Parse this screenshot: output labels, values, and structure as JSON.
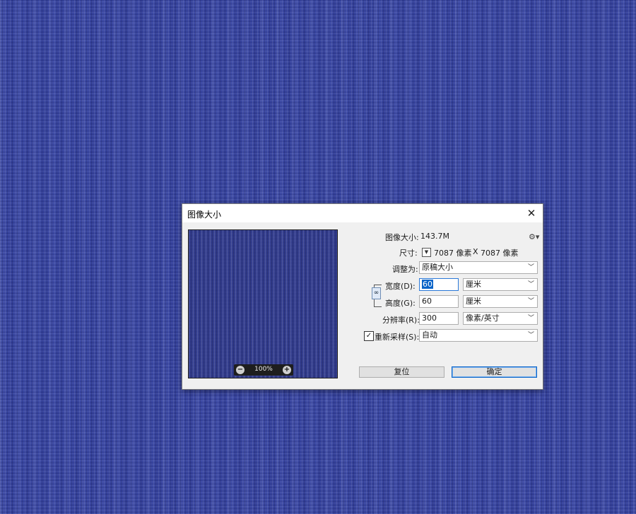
{
  "dialog": {
    "title": "图像大小",
    "close_icon": "close-icon",
    "image_size_label": "图像大小:",
    "image_size_value": "143.7M",
    "dimensions_label": "尺寸:",
    "dimensions_width": "7087 像素",
    "dimensions_x": "X",
    "dimensions_height": "7087 像素",
    "fit_to_label": "调整为:",
    "fit_to_value": "原稿大小",
    "width_label": "宽度(D):",
    "width_value": "60",
    "width_unit": "厘米",
    "height_label": "高度(G):",
    "height_value": "60",
    "height_unit": "厘米",
    "resolution_label": "分辨率(R):",
    "resolution_value": "300",
    "resolution_unit": "像素/英寸",
    "resample_label": "重新采样(S):",
    "resample_checked": true,
    "resample_value": "自动",
    "zoom_level": "100%",
    "reset_button": "复位",
    "ok_button": "确定"
  },
  "colors": {
    "background": "#3a47a2",
    "accent": "#0a64c8"
  }
}
